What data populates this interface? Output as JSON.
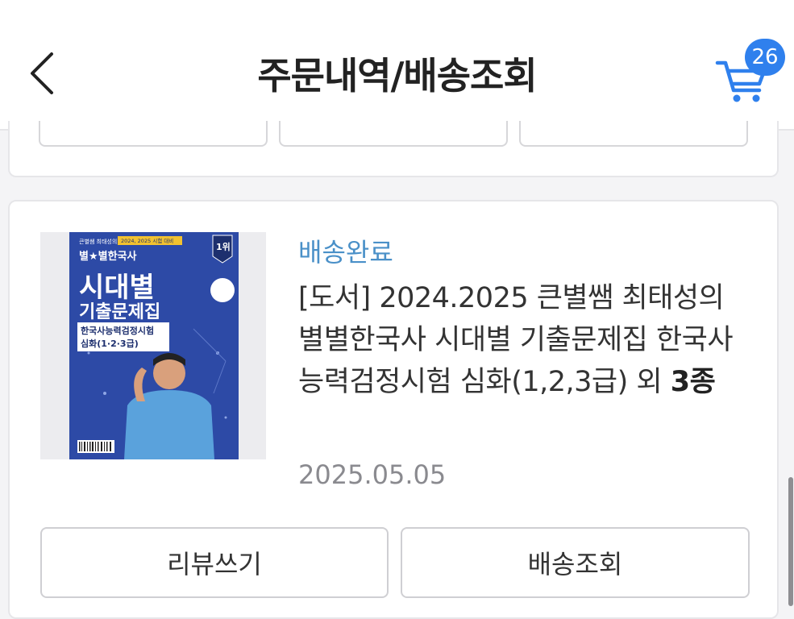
{
  "header": {
    "title": "주문내역/배송조회",
    "back_icon": "chevron-left-icon",
    "cart_icon": "shopping-cart-icon",
    "cart_count": "26",
    "accent": "#2f80ed"
  },
  "order": {
    "status": "배송완료",
    "status_color": "#4a90c8",
    "product_name": "[도서] 2024.2025 큰별쌤 최태성의 별별한국사 시대별 기출문제집 한국사능력검정시험 심화(1,2,3급) 외 ",
    "product_count": "3종",
    "date": "2025.05.05",
    "cover": {
      "top_text": "큰별쌤 최태성의",
      "banner": "2024, 2025 시험 대비",
      "series": "별★별한국사",
      "rank": "1위",
      "title_line1": "시대별",
      "title_line2": "기출문제집",
      "subtitle": "한국사능력검정시험",
      "level": "심화(1·2·3급)",
      "cover_color": "#2d4aa6"
    },
    "buttons": {
      "review": "리뷰쓰기",
      "tracking": "배송조회"
    }
  }
}
